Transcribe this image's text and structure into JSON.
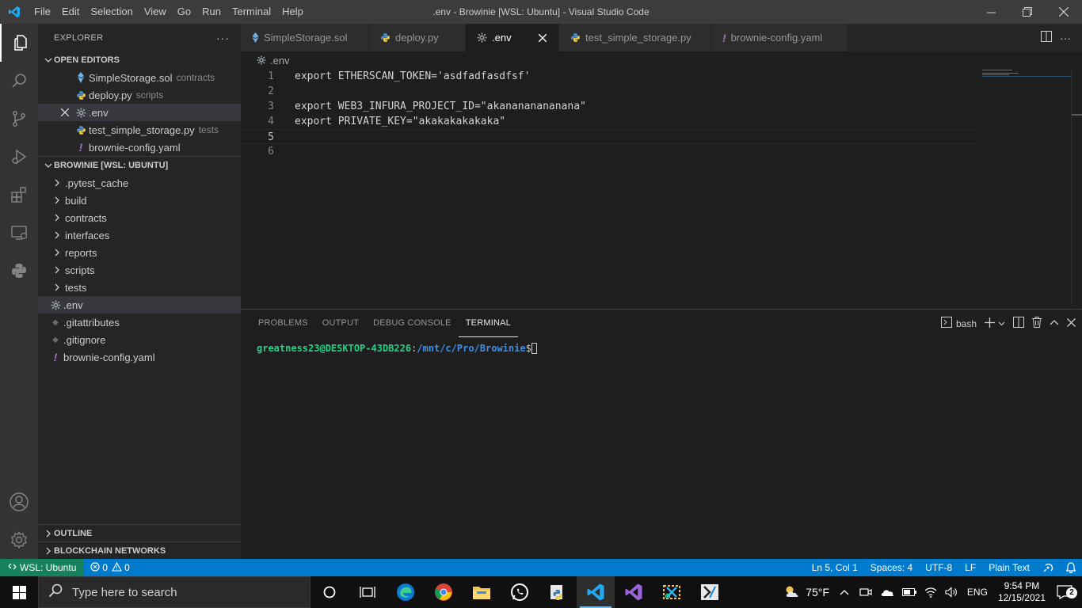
{
  "window": {
    "title": ".env - Browinie [WSL: Ubuntu] - Visual Studio Code",
    "menu": [
      "File",
      "Edit",
      "Selection",
      "View",
      "Go",
      "Run",
      "Terminal",
      "Help"
    ]
  },
  "sidebar": {
    "header": "EXPLORER",
    "open_editors_title": "OPEN EDITORS",
    "open_editors": [
      {
        "name": "SimpleStorage.sol",
        "desc": "contracts",
        "icon": "solidity-icon"
      },
      {
        "name": "deploy.py",
        "desc": "scripts",
        "icon": "python-icon"
      },
      {
        "name": ".env",
        "desc": "",
        "icon": "gear-icon"
      },
      {
        "name": "test_simple_storage.py",
        "desc": "tests",
        "icon": "python-icon"
      },
      {
        "name": "brownie-config.yaml",
        "desc": "",
        "icon": "yaml-icon"
      }
    ],
    "project_title": "BROWINIE [WSL: UBUNTU]",
    "tree": [
      {
        "name": ".pytest_cache",
        "type": "folder"
      },
      {
        "name": "build",
        "type": "folder"
      },
      {
        "name": "contracts",
        "type": "folder"
      },
      {
        "name": "interfaces",
        "type": "folder"
      },
      {
        "name": "reports",
        "type": "folder"
      },
      {
        "name": "scripts",
        "type": "folder"
      },
      {
        "name": "tests",
        "type": "folder"
      },
      {
        "name": ".env",
        "type": "file"
      },
      {
        "name": ".gitattributes",
        "type": "file"
      },
      {
        "name": ".gitignore",
        "type": "file"
      },
      {
        "name": "brownie-config.yaml",
        "type": "file"
      }
    ],
    "outline_title": "OUTLINE",
    "blockchain_title": "BLOCKCHAIN NETWORKS"
  },
  "tabs": [
    {
      "label": "SimpleStorage.sol",
      "icon": "solidity-icon"
    },
    {
      "label": "deploy.py",
      "icon": "python-icon"
    },
    {
      "label": ".env",
      "icon": "gear-icon",
      "active": true
    },
    {
      "label": "test_simple_storage.py",
      "icon": "python-icon"
    },
    {
      "label": "brownie-config.yaml",
      "icon": "yaml-icon"
    }
  ],
  "breadcrumb": ".env",
  "editor": {
    "lines": [
      "export ETHERSCAN_TOKEN='asdfadfasdfsf'",
      "",
      "export WEB3_INFURA_PROJECT_ID=\"akanananananana\"",
      "export PRIVATE_KEY=\"akakakakakaka\"",
      "",
      ""
    ],
    "line_numbers": [
      "1",
      "2",
      "3",
      "4",
      "5",
      "6"
    ],
    "current_line": 5
  },
  "panel": {
    "tabs": [
      "PROBLEMS",
      "OUTPUT",
      "DEBUG CONSOLE",
      "TERMINAL"
    ],
    "active_tab": "TERMINAL",
    "shell": "bash",
    "prompt_user": "greatness23@DESKTOP-43DB226",
    "prompt_sep": ":",
    "prompt_path": "/mnt/c/Pro/Browinie",
    "prompt_dollar": "$"
  },
  "status": {
    "remote": "WSL: Ubuntu",
    "errors": "0",
    "warnings": "0",
    "position": "Ln 5, Col 1",
    "spaces": "Spaces: 4",
    "encoding": "UTF-8",
    "eol": "LF",
    "language": "Plain Text"
  },
  "taskbar": {
    "search_placeholder": "Type here to search",
    "weather": "75°F",
    "language": "ENG",
    "time": "9:54 PM",
    "date": "12/15/2021",
    "notifications": "2"
  },
  "colors": {
    "statusbar": "#007acc",
    "remote": "#16825d",
    "terminal_user": "#23d18b",
    "terminal_path": "#3b8eea"
  }
}
